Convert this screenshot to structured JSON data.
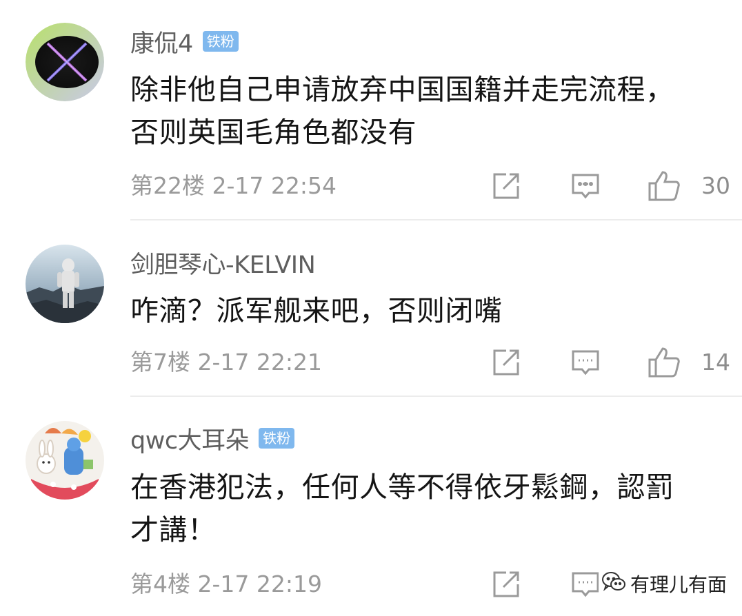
{
  "comments": [
    {
      "username": "康侃4",
      "badge": "铁粉",
      "content_lines": [
        "除非他自己申请放弃中国国籍并走完流程，",
        "否则英国毛角色都没有"
      ],
      "floor": "第22楼",
      "time": "2-17 22:54",
      "meta": "第22楼  2-17 22:54",
      "likes": "30",
      "avatar_icon": "x-logo-avatar"
    },
    {
      "username": "剑胆琴心-KELVIN",
      "badge": "",
      "content_lines": [
        "咋滴？派军舰来吧，否则闭嘴"
      ],
      "floor": "第7楼",
      "time": "2-17 22:21",
      "meta": "第7楼  2-17 22:21",
      "likes": "14",
      "avatar_icon": "astronaut-avatar"
    },
    {
      "username": "qwc大耳朵",
      "badge": "铁粉",
      "content_lines": [
        "在香港犯法，任何人等不得依牙鬆鋼，認罰",
        "才講！"
      ],
      "floor": "第4楼",
      "time": "2-17 22:19",
      "meta": "第4楼  2-17 22:19",
      "likes": "",
      "avatar_icon": "cartoon-bunny-avatar"
    }
  ],
  "watermark": {
    "text": "有理儿有面",
    "icon": "wechat-icon"
  },
  "colors": {
    "badge": "#7fb8ee",
    "text": "#151515",
    "meta": "#9a9a9a",
    "name": "#5f5f5f"
  }
}
